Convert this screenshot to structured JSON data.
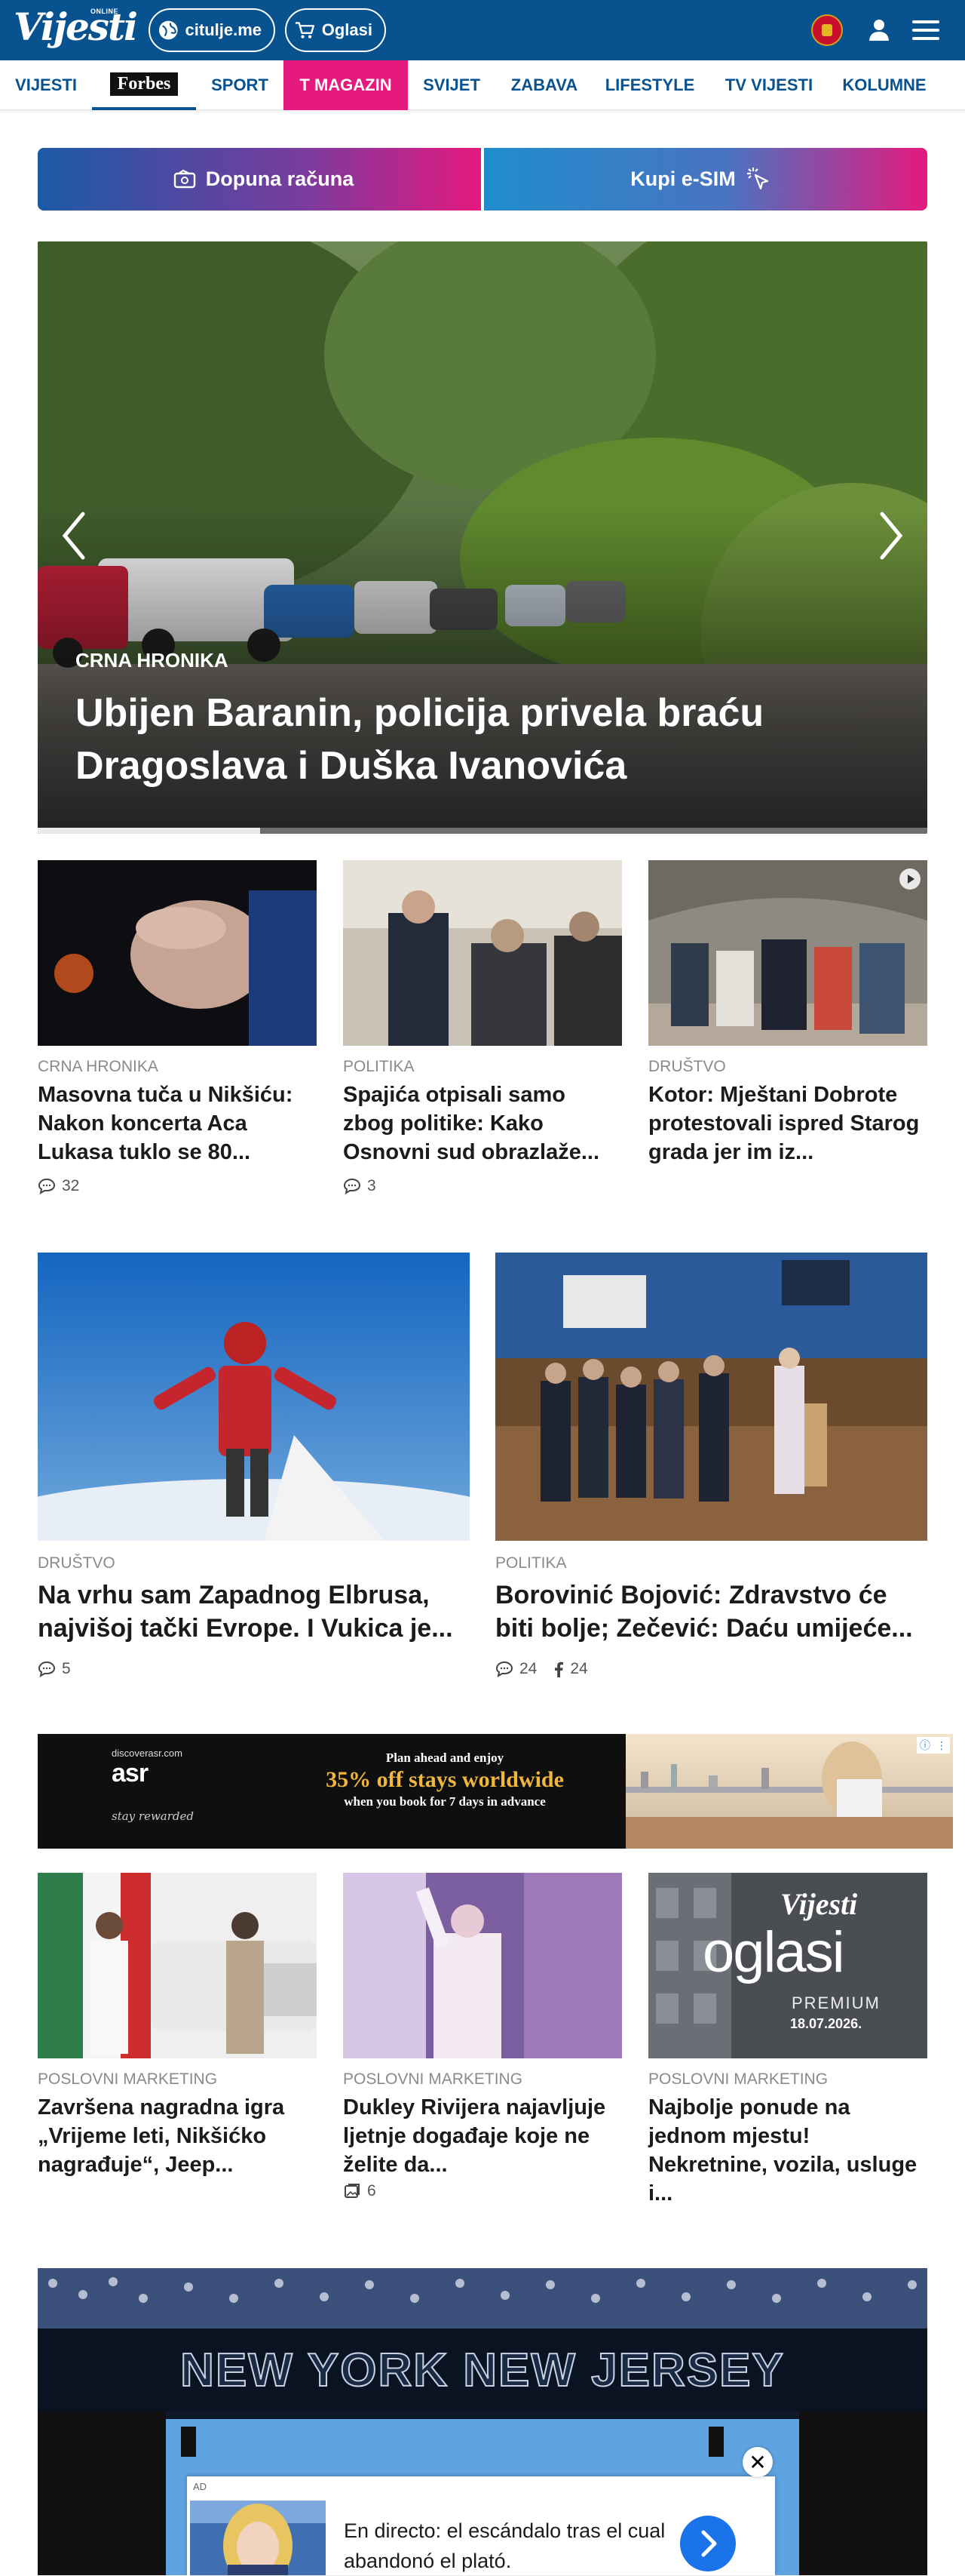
{
  "header": {
    "logo_text": "Vijesti",
    "logo_online": "ONLINE",
    "citulje_label": "citulje.me",
    "oglasi_label": "Oglasi",
    "icons": [
      "globe-icon",
      "cart-icon",
      "flag-montenegro-icon",
      "user-icon",
      "hamburger-menu-icon"
    ]
  },
  "nav": {
    "items": [
      {
        "label": "VIJESTI"
      },
      {
        "label": "Forbes"
      },
      {
        "label": "SPORT"
      },
      {
        "label": "T MAGAZIN"
      },
      {
        "label": "SVIJET"
      },
      {
        "label": "ZABAVA"
      },
      {
        "label": "LIFESTYLE"
      },
      {
        "label": "TV VIJESTI"
      },
      {
        "label": "KOLUMNE"
      }
    ],
    "active": "Forbes"
  },
  "cta": {
    "left_label": "Dopuna računa",
    "right_label": "Kupi e-SIM"
  },
  "hero": {
    "category": "CRNA HRONIKA",
    "title": "Ubijen Baranin, policija privela braću Dragoslava i Duška Ivanovića",
    "progress": 0.25
  },
  "row1": [
    {
      "category": "CRNA HRONIKA",
      "title": "Masovna tuča u Nikšiću: Nakon koncerta Aca Lukasa tuklo se 80...",
      "comments": "32"
    },
    {
      "category": "POLITIKA",
      "title": "Spajića otpisali samo zbog politike: Kako Osnovni sud obrazlaže...",
      "comments": "3"
    },
    {
      "category": "DRUŠTVO",
      "title": "Kotor: Mještani Dobrote protestovali ispred Starog grada jer im iz..."
    }
  ],
  "row2": [
    {
      "category": "DRUŠTVO",
      "title": "Na vrhu sam Zapadnog Elbrusa, najvišoj tački Evrope. I Vukica je...",
      "comments": "5"
    },
    {
      "category": "POLITIKA",
      "title": "Borovinić Bojović: Zdravstvo će biti bolje; Zečević: Daću umijeće...",
      "comments": "24",
      "shares": "24"
    }
  ],
  "ad_banner": {
    "brand_small": "discoverasr.com",
    "brand": "asr",
    "signature": "stay rewarded",
    "line1": "Plan ahead and enjoy",
    "line2": "35% off stays worldwide",
    "line3": "when you book for 7 days in advance"
  },
  "row3": [
    {
      "category": "POSLOVNI MARKETING",
      "title": "Završena nagradna igra „Vrijeme leti, Nikšićko nagrađuje“, Jeep..."
    },
    {
      "category": "POSLOVNI MARKETING",
      "title": "Dukley Rivijera najavljuje ljetnje događaje koje ne želite da...",
      "gallery": "6"
    },
    {
      "category": "POSLOVNI MARKETING",
      "title": "Najbolje ponude na jednom mjestu! Nekretnine, vozila, usluge i...",
      "thumb_brand": "Vijesti",
      "thumb_word": "oglasi",
      "thumb_sub": "PREMIUM",
      "thumb_date": "18.07.2026."
    }
  ],
  "bottom_banner": {
    "title": "NEW YORK NEW JERSEY"
  },
  "floating_ad": {
    "label": "AD",
    "text": "En directo: el escándalo tras el cual abandonó el plató.",
    "close": "✕"
  },
  "colors": {
    "brand_blue": "#07528f",
    "magenta": "#e5197e"
  }
}
